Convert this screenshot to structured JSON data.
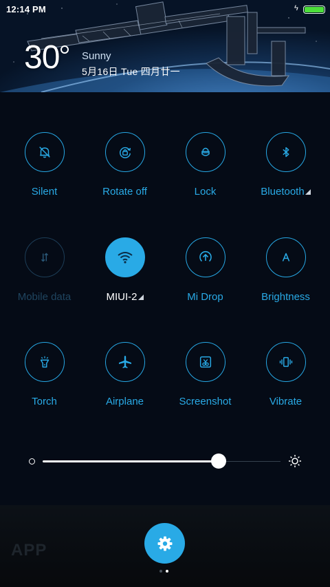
{
  "status_bar": {
    "time": "12:14 PM",
    "charging_symbol": "ϟ",
    "battery_level": 1.0
  },
  "weather": {
    "temperature": "30",
    "condition": "Sunny",
    "date": "5月16日 Tue 四月廿一"
  },
  "toggles": [
    {
      "label": "Silent",
      "icon": "bell-off-icon",
      "state": "off"
    },
    {
      "label": "Rotate off",
      "icon": "rotate-lock-icon",
      "state": "off"
    },
    {
      "label": "Lock",
      "icon": "lock-icon",
      "state": "off"
    },
    {
      "label": "Bluetooth",
      "icon": "bluetooth-icon",
      "state": "off",
      "has_more": true
    },
    {
      "label": "Mobile data",
      "icon": "mobile-data-icon",
      "state": "disabled"
    },
    {
      "label": "MIUI-2",
      "icon": "wifi-icon",
      "state": "on",
      "has_more": true
    },
    {
      "label": "Mi Drop",
      "icon": "mi-drop-icon",
      "state": "off"
    },
    {
      "label": "Brightness",
      "icon": "auto-brightness-icon",
      "state": "off"
    },
    {
      "label": "Torch",
      "icon": "torch-icon",
      "state": "off"
    },
    {
      "label": "Airplane",
      "icon": "airplane-icon",
      "state": "off"
    },
    {
      "label": "Screenshot",
      "icon": "screenshot-icon",
      "state": "off"
    },
    {
      "label": "Vibrate",
      "icon": "vibrate-icon",
      "state": "off"
    }
  ],
  "brightness": {
    "level": 0.74,
    "min_icon": "brightness-low-icon",
    "max_icon": "brightness-high-icon"
  },
  "background_watermark": "APP",
  "settings_button": {
    "icon": "gear-icon"
  },
  "pager": {
    "pages": 2,
    "current": 2
  },
  "colors": {
    "accent": "#29aae6",
    "panel_bg": "#050b16",
    "active_label": "#ffffff",
    "disabled": "#1f4560"
  }
}
